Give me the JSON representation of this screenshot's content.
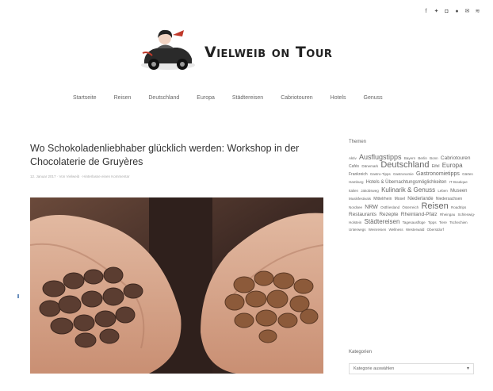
{
  "social_icons": [
    {
      "name": "facebook-icon",
      "glyph": "f"
    },
    {
      "name": "twitter-icon",
      "glyph": "✦"
    },
    {
      "name": "instagram-icon",
      "glyph": "◘"
    },
    {
      "name": "pinterest-icon",
      "glyph": "●"
    },
    {
      "name": "email-icon",
      "glyph": "✉"
    },
    {
      "name": "rss-icon",
      "glyph": "≋"
    }
  ],
  "site": {
    "title": "Vielweib on Tour"
  },
  "nav": [
    "Startseite",
    "Reisen",
    "Deutschland",
    "Europa",
    "Städtereisen",
    "Cabriotouren",
    "Hotels",
    "Genuss"
  ],
  "post": {
    "title": "Wo Schokoladenliebhaber glücklich werden: Workshop in der Chocolaterie de Gruyères",
    "meta": "12. Januar 2017 · Von Vielweib · Hinterlasse einen Kommentar"
  },
  "sidebar": {
    "themen_title": "Themen",
    "tags": [
      {
        "t": "Aktiv",
        "s": 4.5
      },
      {
        "t": "Ausflugstipps",
        "s": 9
      },
      {
        "t": "Bayern",
        "s": 4.5
      },
      {
        "t": "Berlin",
        "s": 4.5
      },
      {
        "t": "Bonn",
        "s": 4.5
      },
      {
        "t": "Cabriotouren",
        "s": 6.5
      },
      {
        "t": "Cafés",
        "s": 5
      },
      {
        "t": "Dänemark",
        "s": 4.5
      },
      {
        "t": "Deutschland",
        "s": 11
      },
      {
        "t": "Eifel",
        "s": 5
      },
      {
        "t": "Europa",
        "s": 8
      },
      {
        "t": "Frankreich",
        "s": 5
      },
      {
        "t": "Gastro-Tipps",
        "s": 4.5
      },
      {
        "t": "Gastronomie",
        "s": 4.5
      },
      {
        "t": "Gastronomietipps",
        "s": 7
      },
      {
        "t": "Gärten",
        "s": 4.5
      },
      {
        "t": "Hamburg",
        "s": 4.5
      },
      {
        "t": "Hotels & Übernachtungsmöglichkeiten",
        "s": 6
      },
      {
        "t": "IT Boutique",
        "s": 4.5
      },
      {
        "t": "Italien",
        "s": 4.5
      },
      {
        "t": "Jakobsweg",
        "s": 4.5
      },
      {
        "t": "Kulinarik & Genuss",
        "s": 8
      },
      {
        "t": "Leben",
        "s": 4.5
      },
      {
        "t": "Museen",
        "s": 6
      },
      {
        "t": "Musikfestivals",
        "s": 4.5
      },
      {
        "t": "Mittelrhein",
        "s": 5
      },
      {
        "t": "Mosel",
        "s": 5
      },
      {
        "t": "Niederlande",
        "s": 6
      },
      {
        "t": "Niedersachsen",
        "s": 5
      },
      {
        "t": "Nordsee",
        "s": 4.5
      },
      {
        "t": "NRW",
        "s": 7
      },
      {
        "t": "Ostfriesland",
        "s": 4.5
      },
      {
        "t": "Österreich",
        "s": 4.5
      },
      {
        "t": "Reisen",
        "s": 11
      },
      {
        "t": "Roadtrips",
        "s": 4.5
      },
      {
        "t": "Restaurants",
        "s": 6.5
      },
      {
        "t": "Rezepte",
        "s": 6.5
      },
      {
        "t": "Rheinland-Pfalz",
        "s": 6.5
      },
      {
        "t": "Rheingau",
        "s": 4.5
      },
      {
        "t": "Schleswig-Holstein",
        "s": 4.5
      },
      {
        "t": "Städtereisen",
        "s": 8
      },
      {
        "t": "Tagesausflüge",
        "s": 4.5
      },
      {
        "t": "Tipps",
        "s": 4.5
      },
      {
        "t": "Tiere",
        "s": 4.5
      },
      {
        "t": "Tschechien",
        "s": 4.5
      },
      {
        "t": "Unterwegs",
        "s": 4.5
      },
      {
        "t": "Weinreisen",
        "s": 4.5
      },
      {
        "t": "Wellness",
        "s": 4.5
      },
      {
        "t": "Westerwald",
        "s": 4.5
      },
      {
        "t": "Oberstdorf",
        "s": 4.5
      }
    ],
    "kategorien_title": "Kategorien",
    "kategorien_select": "Kategorie auswählen"
  }
}
